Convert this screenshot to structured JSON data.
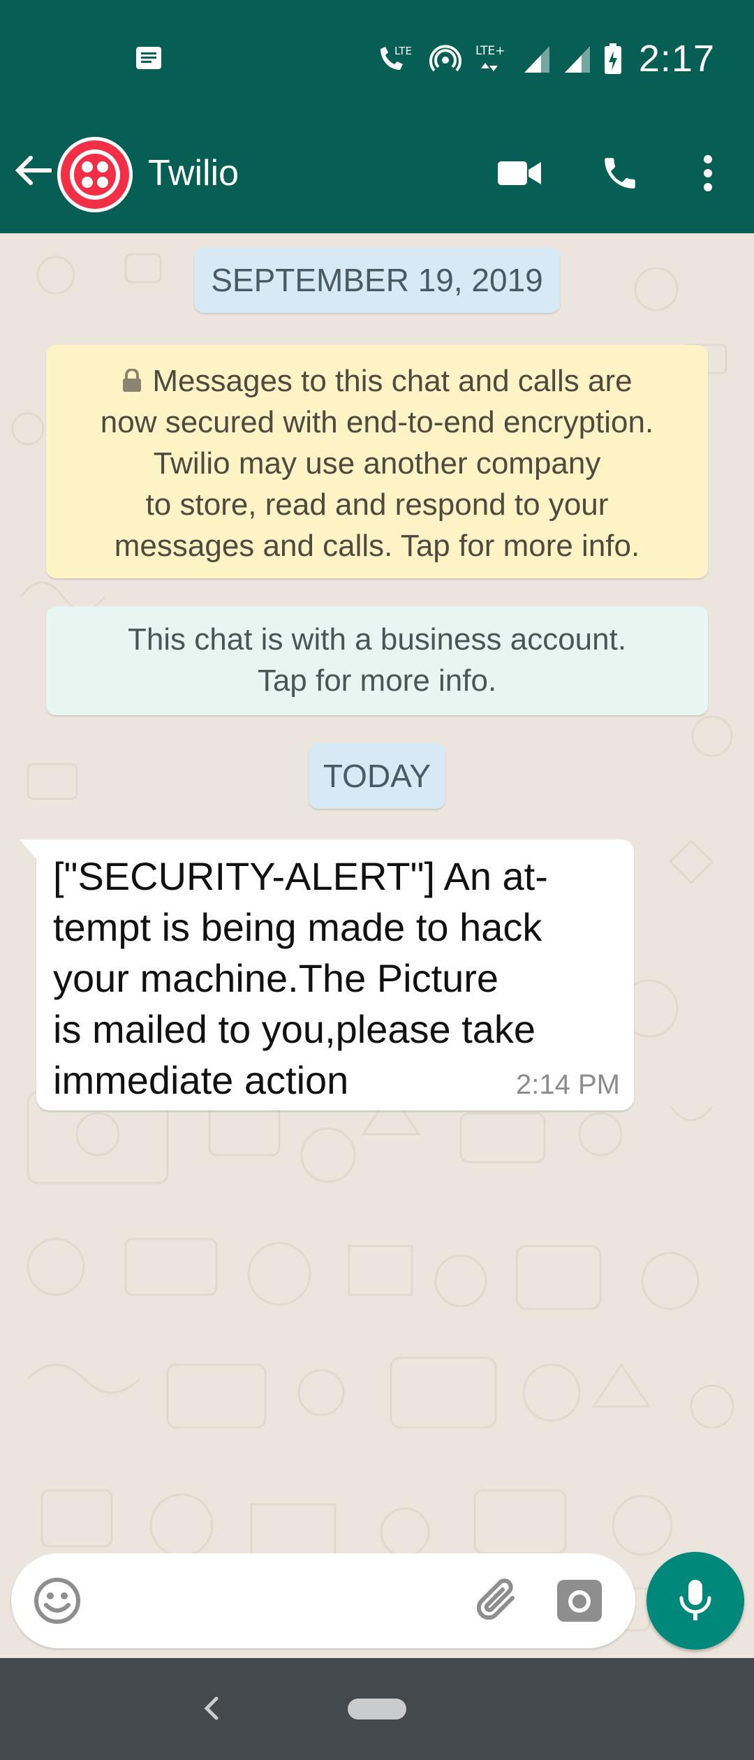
{
  "status_bar": {
    "time": "2:17",
    "network_labels": [
      "LTE",
      "LTE+"
    ],
    "icons": [
      "message-notification-icon",
      "lte-call-icon",
      "hotspot-icon",
      "lte-plus-icon",
      "signal-icon",
      "signal-icon",
      "battery-charging-icon"
    ]
  },
  "header": {
    "contact_name": "Twilio",
    "back_icon": "arrow-left-icon",
    "video_call_icon": "video-camera-icon",
    "voice_call_icon": "phone-icon",
    "menu_icon": "more-vertical-icon"
  },
  "chat": {
    "date_chip_1": "SEPTEMBER 19, 2019",
    "encryption_notice_lines": [
      "Messages to this chat and calls are",
      "now secured with end-to-end encryption.",
      "Twilio may use another company",
      "to store, read and respond to your",
      "messages and calls. Tap for more info."
    ],
    "business_notice_lines": [
      "This chat is with a business account.",
      "Tap for more info."
    ],
    "date_chip_2": "TODAY",
    "messages": [
      {
        "lines": [
          "[\"SECURITY-ALERT\"] An at-",
          "tempt is being made to hack",
          "your machine.The Picture",
          "is mailed to you,please take",
          "immediate action"
        ],
        "time": "2:14 PM"
      }
    ]
  },
  "composer": {
    "placeholder": "",
    "emoji_icon": "emoji-icon",
    "attach_icon": "paperclip-icon",
    "camera_icon": "camera-icon",
    "mic_icon": "microphone-icon"
  },
  "colors": {
    "header": "#075e54",
    "accent": "#00897b",
    "encryption_bg": "#fef3c5",
    "business_bg": "#e8f6f1",
    "date_chip_bg": "#d7e9f4"
  }
}
